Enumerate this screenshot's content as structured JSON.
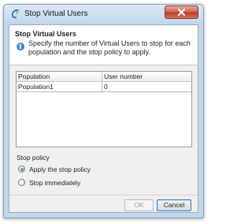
{
  "window": {
    "title": "Stop Virtual Users"
  },
  "header": {
    "heading": "Stop Virtual Users",
    "description": "Specify the number of Virtual Users to stop for each population and the stop policy to apply."
  },
  "table": {
    "columns": [
      "Population",
      "User number"
    ],
    "rows": [
      {
        "population": "Population1",
        "user_number": "0"
      }
    ]
  },
  "stop_policy": {
    "label": "Stop policy",
    "options": [
      {
        "label": "Apply the stop policy",
        "selected": true
      },
      {
        "label": "Stop immediately",
        "selected": false
      }
    ]
  },
  "buttons": {
    "ok": "OK",
    "cancel": "Cancel",
    "ok_enabled": false
  },
  "icons": {
    "app": "neoload-app-icon",
    "info": "info-icon",
    "close": "close-icon"
  },
  "colors": {
    "close_button": "#c0392b",
    "info_icon": "#1f5fb8",
    "radio_selected": "#1e7d1e",
    "default_button_border": "#3c7fb1"
  }
}
